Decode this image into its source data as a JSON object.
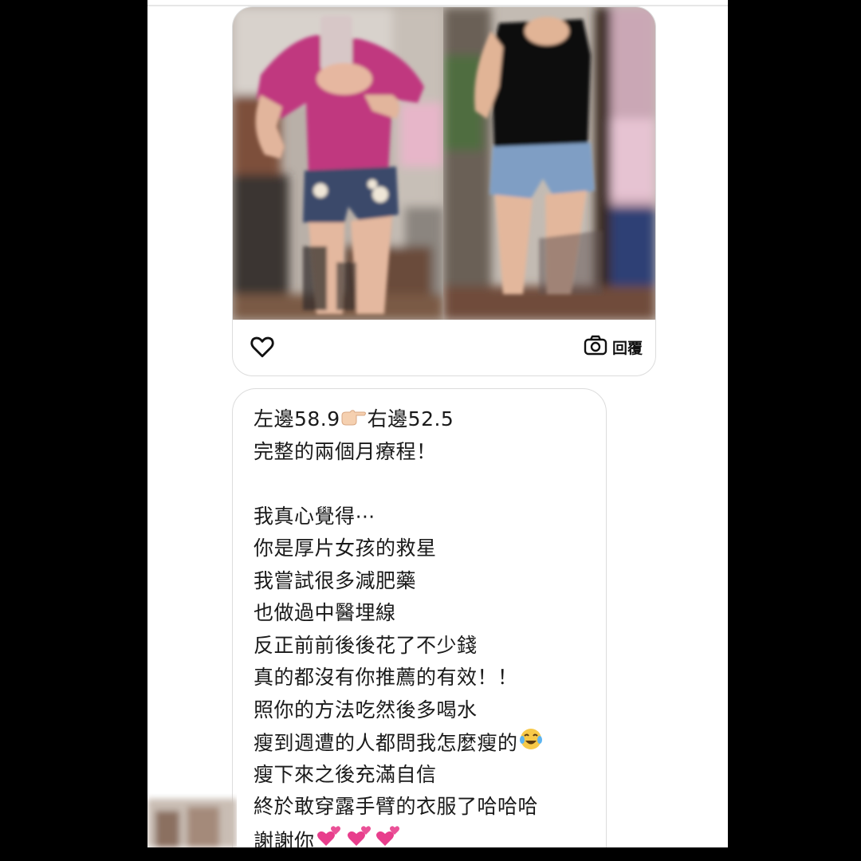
{
  "conversation": {
    "photo_message": {
      "left_photo_alt": "before-photo",
      "right_photo_alt": "after-photo",
      "like_icon": "heart-outline-icon",
      "reply_icon": "camera-icon",
      "reply_label": "回覆"
    },
    "text_message": {
      "lines": [
        {
          "text": "左邊58.9",
          "suffix": "右邊52.5",
          "emoji": "pointing-right-emoji"
        },
        {
          "text": "完整的兩個月療程！"
        },
        {
          "text": ""
        },
        {
          "text": "我真心覺得⋯"
        },
        {
          "text": "你是厚片女孩的救星"
        },
        {
          "text": "我嘗試很多減肥藥"
        },
        {
          "text": "也做過中醫埋線"
        },
        {
          "text": "反正前前後後花了不少錢"
        },
        {
          "text": "真的都沒有你推薦的有效！！"
        },
        {
          "text": "照你的方法吃然後多喝水"
        },
        {
          "text": "瘦到週遭的人都問我怎麼瘦的",
          "emoji": "tears-of-joy-emoji"
        },
        {
          "text": "瘦下來之後充滿自信"
        },
        {
          "text": "終於敢穿露手臂的衣服了哈哈哈"
        },
        {
          "text": "謝謝你",
          "emoji": "two-hearts-emoji"
        }
      ]
    }
  },
  "colors": {
    "background": "#000000",
    "screen": "#ffffff",
    "bubble_border": "#dcdcdc",
    "text": "#1a1a1a",
    "heart_emoji": "#e83e8c"
  }
}
